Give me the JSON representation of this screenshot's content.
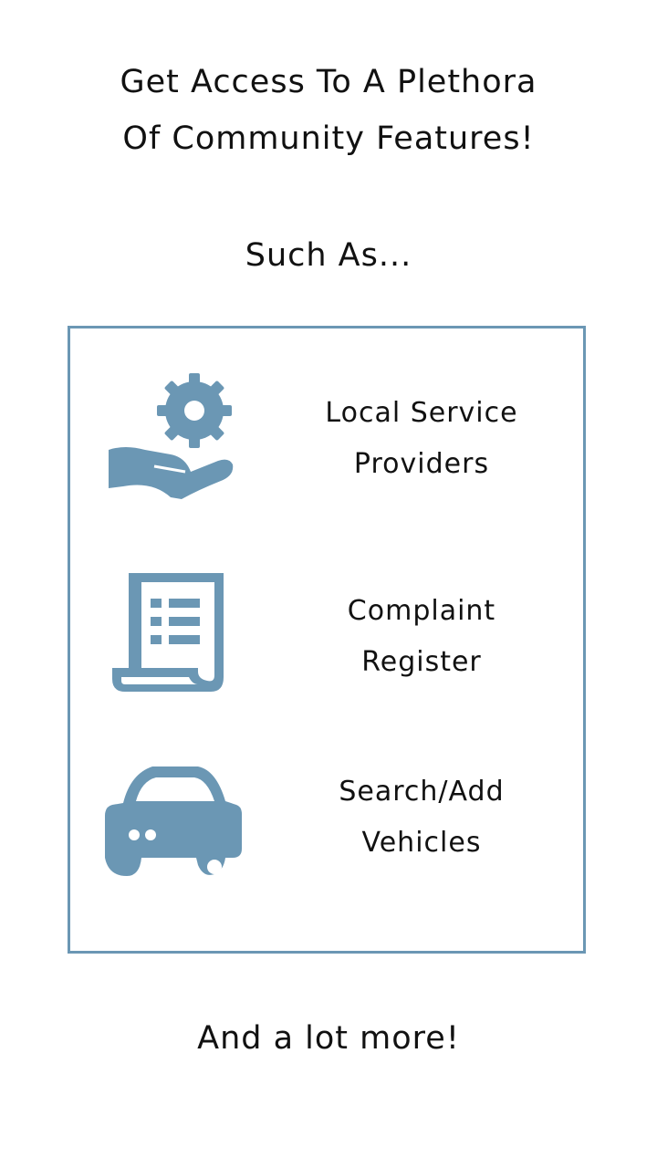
{
  "headline": {
    "line1": "Get Access To A Plethora",
    "line2": "Of Community Features!"
  },
  "subheading": "Such As...",
  "features": [
    {
      "icon": "service-hand-gear-icon",
      "line1": "Local Service",
      "line2": "Providers"
    },
    {
      "icon": "document-list-icon",
      "line1": "Complaint",
      "line2": "Register"
    },
    {
      "icon": "car-icon",
      "line1": "Search/Add",
      "line2": "Vehicles"
    }
  ],
  "footer": "And a lot more!",
  "colors": {
    "accent": "#6b97b4",
    "text": "#111111",
    "background": "#ffffff"
  }
}
